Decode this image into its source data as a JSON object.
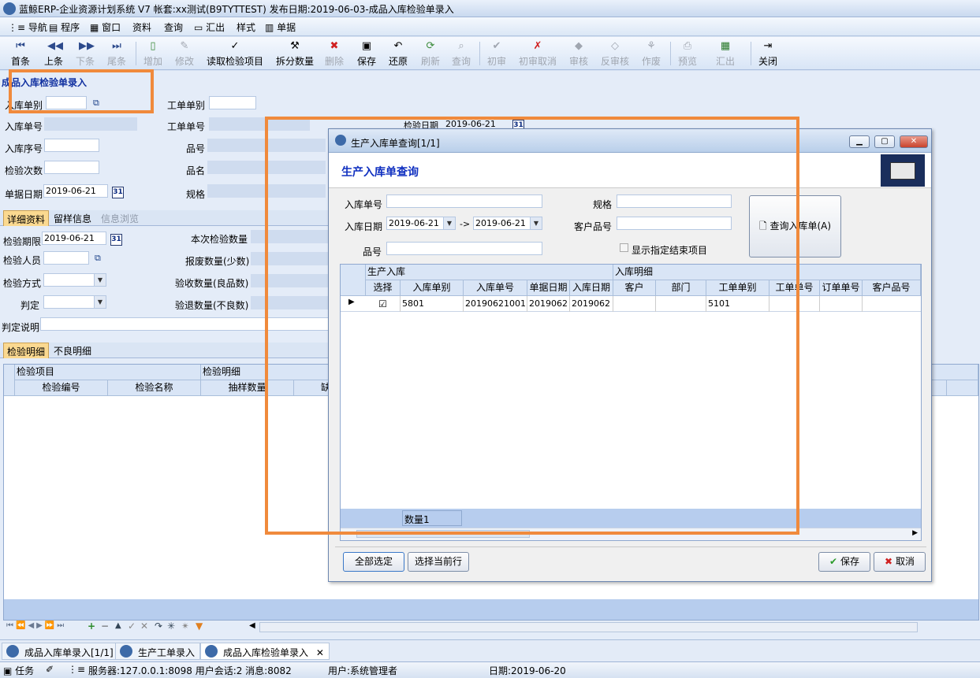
{
  "window": {
    "title": "蓝鲸ERP-企业资源计划系统 V7 帐套:xx测试(B9TYTTEST) 发布日期:2019-06-03-成品入库检验单录入"
  },
  "menu": [
    "导航",
    "程序",
    "窗口",
    "资料",
    "查询",
    "汇出",
    "样式",
    "单据"
  ],
  "toolbar": {
    "first": "首条",
    "prev": "上条",
    "next": "下条",
    "last": "尾条",
    "add": "增加",
    "edit": "修改",
    "read": "读取检验项目",
    "split": "拆分数量",
    "delete": "删除",
    "save": "保存",
    "restore": "还原",
    "refresh": "刷新",
    "query": "查询",
    "first_review": "初审",
    "first_review_cancel": "初审取消",
    "audit": "审核",
    "unaudit": "反审核",
    "void": "作废",
    "preview": "预览",
    "export": "汇出",
    "close": "关闭"
  },
  "form": {
    "heading": "成品入库检验单录入",
    "in_type_label": "入库单别",
    "work_type_label": "工单单别",
    "in_no_label": "入库单号",
    "work_no_label": "工单单号",
    "inspect_date_label": "检验日期",
    "inspect_date": "2019-06-21",
    "in_seq_label": "入库序号",
    "part_no_label": "品号",
    "inspect_count_label": "检验次数",
    "part_name_label": "品名",
    "doc_date_label": "单据日期",
    "doc_date": "2019-06-21",
    "spec_label": "规格"
  },
  "tabs1": [
    "详细资料",
    "留样信息",
    "信息浏览"
  ],
  "detail": {
    "deadline_label": "检验期限",
    "deadline": "2019-06-21",
    "qty_label": "本次检验数量",
    "inspector_label": "检验人员",
    "scrap_label": "报废数量(少数)",
    "method_label": "检验方式",
    "accept_label": "验收数量(良品数)",
    "judge_label": "判定",
    "reject_label": "验退数量(不良数)",
    "note_label": "判定说明"
  },
  "tabs2": [
    "检验明细",
    "不良明细"
  ],
  "grid": {
    "group1": "检验项目",
    "group2": "检验明细",
    "cols": [
      "检验编号",
      "检验名称",
      "抽样数量",
      "缺"
    ]
  },
  "dialog": {
    "title": "生产入库单查询[1/1]",
    "heading": "生产入库单查询",
    "in_no_label": "入库单号",
    "spec_label": "规格",
    "in_date_label": "入库日期",
    "date_from": "2019-06-21",
    "arrow": "->",
    "date_to": "2019-06-21",
    "cust_part_label": "客户品号",
    "part_label": "品号",
    "show_closed": "显示指定结束项目",
    "query_btn": "查询入库单(A)",
    "group1": "生产入库",
    "group2": "入库明细",
    "cols": [
      "选择",
      "入库单别",
      "入库单号",
      "单据日期",
      "入库日期",
      "客户",
      "部门",
      "工单单别",
      "工单单号",
      "订单单号",
      "客户品号"
    ],
    "rows": [
      {
        "check": "☑",
        "in_type": "5801",
        "in_no": "20190621001",
        "doc_date": "2019062",
        "in_date": "2019062",
        "customer": "",
        "dept": "",
        "work_type": "5101",
        "work_no": "",
        "order_no": "",
        "cust_part": ""
      }
    ],
    "footer_count": "数量1",
    "select_all": "全部选定",
    "select_current": "选择当前行",
    "save": "保存",
    "cancel": "取消"
  },
  "taskbar": [
    "成品入库单录入[1/1]",
    "生产工单录入",
    "成品入库检验单录入"
  ],
  "status": {
    "task": "任务",
    "server": "服务器:127.0.0.1:8098 用户会话:2 消息:8082",
    "user": "用户:系统管理者",
    "date": "日期:2019-06-20"
  }
}
